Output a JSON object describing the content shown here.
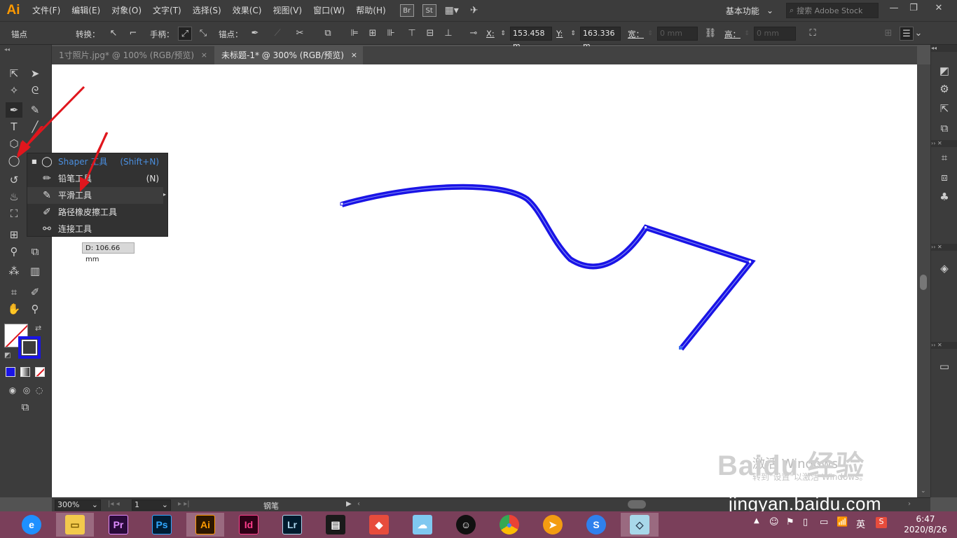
{
  "app": {
    "logo": "Ai"
  },
  "menu": [
    "文件(F)",
    "编辑(E)",
    "对象(O)",
    "文字(T)",
    "选择(S)",
    "效果(C)",
    "视图(V)",
    "窗口(W)",
    "帮助(H)"
  ],
  "bridge_labels": {
    "br": "Br",
    "st": "St"
  },
  "workspace": {
    "label": "基本功能"
  },
  "search": {
    "placeholder": "搜索 Adobe Stock"
  },
  "control": {
    "anchor_label": "锚点",
    "convert_label": "转换：",
    "handle_label": "手柄：",
    "anchors_label": "锚点：",
    "x_label": "X:",
    "x_value": "153.458 m",
    "y_label": "Y:",
    "y_value": "163.336 m",
    "w_label": "宽：",
    "w_value": "0 mm",
    "h_label": "高：",
    "h_value": "0 mm"
  },
  "tabs": [
    {
      "label": "1寸照片.jpg* @ 100% (RGB/预览)",
      "close": "×"
    },
    {
      "label": "未标题-1* @ 300% (RGB/预览)",
      "close": "×"
    }
  ],
  "flyout": {
    "items": [
      {
        "label": "Shaper 工具",
        "shortcut": "(Shift+N)",
        "icon": "shaper-icon"
      },
      {
        "label": "铅笔工具",
        "shortcut": "(N)",
        "icon": "pencil-icon"
      },
      {
        "label": "平滑工具",
        "shortcut": "",
        "icon": "smooth-icon"
      },
      {
        "label": "路径橡皮擦工具",
        "shortcut": "",
        "icon": "path-eraser-icon"
      },
      {
        "label": "连接工具",
        "shortcut": "",
        "icon": "join-icon"
      }
    ],
    "distance_tooltip": "D: 106.66 mm"
  },
  "status": {
    "zoom": "300%",
    "page": "1",
    "tool": "钢笔"
  },
  "watermark": {
    "activate_title": "激活 Windows",
    "activate_sub": "转到\"设置\"以激活 Windows。",
    "baidu": "Baidu 经验",
    "url": "jingyan.baidu.com"
  },
  "colors": {
    "path_stroke": "#1a14e6",
    "annotation_arrow": "#e0161d",
    "stroke_swatch": "#1a14e6"
  },
  "taskbar": {
    "apps": [
      "edge",
      "explorer",
      "Pr",
      "Ps",
      "Ai",
      "Id",
      "Lr",
      "video",
      "winrar",
      "qq-chat",
      "qq",
      "chrome",
      "media",
      "sogou",
      "notes"
    ],
    "tray_ime": "英",
    "time": "6:47",
    "date": "2020/8/26"
  }
}
